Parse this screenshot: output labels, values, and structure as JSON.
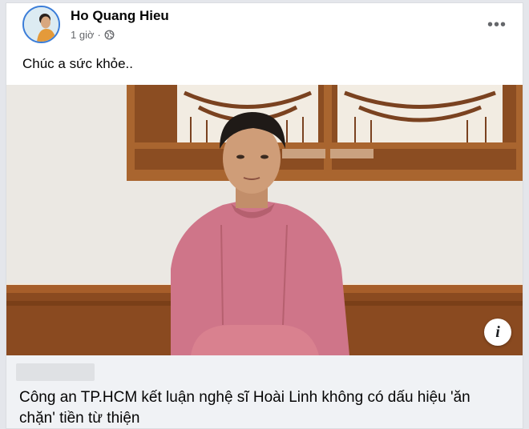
{
  "post": {
    "author": "Ho Quang Hieu",
    "time": "1 giờ",
    "privacy_icon": "globe-icon",
    "more_icon": "more-options-icon",
    "text": "Chúc a sức khỏe.."
  },
  "link_preview": {
    "domain": "",
    "title": "Công an TP.HCM kết luận nghệ sĩ Hoài Linh không có dấu hiệu 'ăn chặn' tiền từ thiện",
    "info_label": "i"
  },
  "colors": {
    "author_text": "#050505",
    "meta_text": "#65676b",
    "link_area_bg": "#f0f2f5",
    "avatar_ring": "#3b7dd8",
    "shirt": "#cf7589"
  }
}
